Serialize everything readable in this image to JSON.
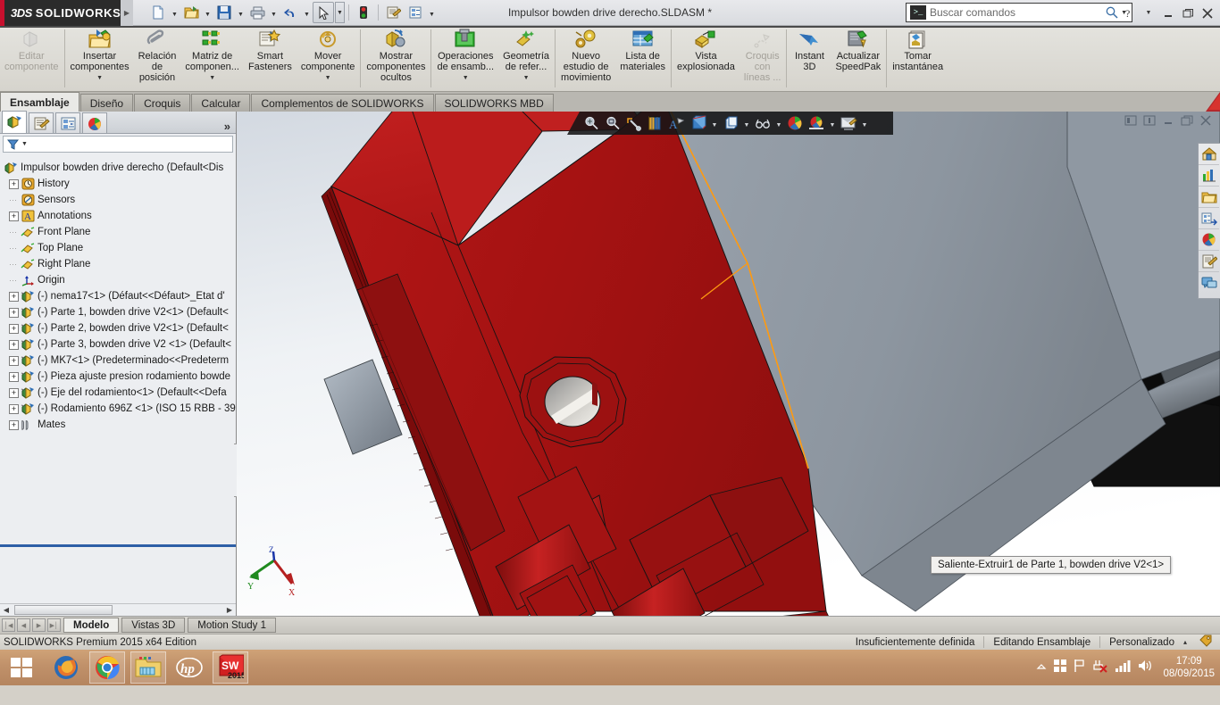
{
  "titlebar": {
    "brand_ds": "3DS",
    "brand_name": "SOLIDWORKS",
    "document_title": "Impulsor bowden drive derecho.SLDASM *",
    "quick_access": [
      {
        "name": "new-document",
        "icon": "new-file-icon",
        "dropdown": true
      },
      {
        "name": "open-document",
        "icon": "open-folder-icon",
        "dropdown": true
      },
      {
        "name": "save-document",
        "icon": "save-disk-icon",
        "dropdown": true
      },
      {
        "name": "print-document",
        "icon": "printer-icon",
        "dropdown": true
      },
      {
        "name": "undo",
        "icon": "undo-arrow-icon",
        "dropdown": true
      },
      {
        "name": "select",
        "icon": "cursor-arrow-icon",
        "dropdown": true
      },
      {
        "name": "rebuild",
        "icon": "traffic-light-icon",
        "dropdown": false
      },
      {
        "name": "file-properties",
        "icon": "properties-icon",
        "dropdown": false
      },
      {
        "name": "options",
        "icon": "options-gear-icon",
        "dropdown": true
      }
    ],
    "window_buttons": [
      "help-icon",
      "help-dropdown",
      "minimize",
      "restore",
      "close"
    ]
  },
  "search": {
    "placeholder": "Buscar comandos",
    "value": "",
    "icon": "command-search-icon"
  },
  "ribbon": {
    "groups": [
      {
        "items": [
          {
            "label": "Editar\ncomponente",
            "icon": "edit-component-icon",
            "disabled": true,
            "dropdown": false
          }
        ]
      },
      {
        "items": [
          {
            "label": "Insertar\ncomponentes",
            "icon": "insert-components-icon",
            "disabled": false,
            "dropdown": true
          },
          {
            "label": "Relación\nde\nposición",
            "icon": "mate-paperclip-icon",
            "disabled": false,
            "dropdown": false
          },
          {
            "label": "Matriz de\ncomponen...",
            "icon": "component-pattern-icon",
            "disabled": false,
            "dropdown": true
          },
          {
            "label": "Smart\nFasteners",
            "icon": "smart-fasteners-icon",
            "disabled": false,
            "dropdown": false
          },
          {
            "label": "Mover\ncomponente",
            "icon": "move-component-icon",
            "disabled": false,
            "dropdown": true
          }
        ]
      },
      {
        "items": [
          {
            "label": "Mostrar\ncomponentes\nocultos",
            "icon": "show-hidden-components-icon",
            "disabled": false,
            "dropdown": false
          }
        ]
      },
      {
        "items": [
          {
            "label": "Operaciones\nde ensamb...",
            "icon": "assembly-features-icon",
            "disabled": false,
            "dropdown": true
          },
          {
            "label": "Geometría\nde refer...",
            "icon": "reference-geometry-icon",
            "disabled": false,
            "dropdown": true
          }
        ]
      },
      {
        "items": [
          {
            "label": "Nuevo\nestudio de\nmovimiento",
            "icon": "new-motion-study-icon",
            "disabled": false,
            "dropdown": false
          },
          {
            "label": "Lista de\nmateriales",
            "icon": "bill-of-materials-icon",
            "disabled": false,
            "dropdown": false
          }
        ]
      },
      {
        "items": [
          {
            "label": "Vista\nexplosionada",
            "icon": "exploded-view-icon",
            "disabled": false,
            "dropdown": false
          },
          {
            "label": "Croquis\ncon\nlíneas ...",
            "icon": "explode-line-sketch-icon",
            "disabled": true,
            "dropdown": false
          }
        ]
      },
      {
        "items": [
          {
            "label": "Instant\n3D",
            "icon": "instant-3d-icon",
            "disabled": false,
            "dropdown": false
          },
          {
            "label": "Actualizar\nSpeedPak",
            "icon": "update-speedpak-icon",
            "disabled": false,
            "dropdown": false
          }
        ]
      },
      {
        "items": [
          {
            "label": "Tomar\ninstantánea",
            "icon": "take-snapshot-icon",
            "disabled": false,
            "dropdown": false
          }
        ]
      }
    ]
  },
  "command_tabs": [
    {
      "label": "Ensamblaje",
      "active": true
    },
    {
      "label": "Diseño",
      "active": false
    },
    {
      "label": "Croquis",
      "active": false
    },
    {
      "label": "Calcular",
      "active": false
    },
    {
      "label": "Complementos de SOLIDWORKS",
      "active": false
    },
    {
      "label": "SOLIDWORKS MBD",
      "active": false
    }
  ],
  "feature_manager": {
    "tabs": [
      {
        "name": "feature-tree-tab",
        "icon": "feature-tree-icon",
        "active": true
      },
      {
        "name": "property-manager-tab",
        "icon": "property-manager-icon",
        "active": false
      },
      {
        "name": "configuration-manager-tab",
        "icon": "configuration-manager-icon",
        "active": false
      },
      {
        "name": "display-manager-tab",
        "icon": "display-manager-icon",
        "active": false
      }
    ],
    "more_label": "»",
    "filter_placeholder": "",
    "tree": [
      {
        "label": "Impulsor bowden drive derecho  (Default<Dis",
        "icon": "assembly-icon",
        "indent": 0,
        "expandable": false,
        "expanded": false,
        "root": true
      },
      {
        "label": "History",
        "icon": "history-clock-icon",
        "indent": 1,
        "expandable": true,
        "expanded": false
      },
      {
        "label": "Sensors",
        "icon": "sensors-icon",
        "indent": 1,
        "expandable": false,
        "expanded": false
      },
      {
        "label": "Annotations",
        "icon": "annotations-icon",
        "indent": 1,
        "expandable": true,
        "expanded": false
      },
      {
        "label": "Front Plane",
        "icon": "plane-icon",
        "indent": 1,
        "expandable": false,
        "expanded": false
      },
      {
        "label": "Top Plane",
        "icon": "plane-icon",
        "indent": 1,
        "expandable": false,
        "expanded": false
      },
      {
        "label": "Right Plane",
        "icon": "plane-icon",
        "indent": 1,
        "expandable": false,
        "expanded": false
      },
      {
        "label": "Origin",
        "icon": "origin-icon",
        "indent": 1,
        "expandable": false,
        "expanded": false
      },
      {
        "label": "(-) nema17<1>  (Défaut<<Défaut>_Etat d'",
        "icon": "component-icon",
        "indent": 1,
        "expandable": true,
        "expanded": false
      },
      {
        "label": "(-) Parte 1, bowden drive V2<1>  (Default<",
        "icon": "component-icon",
        "indent": 1,
        "expandable": true,
        "expanded": false
      },
      {
        "label": "(-) Parte 2, bowden drive V2<1>  (Default<",
        "icon": "component-icon",
        "indent": 1,
        "expandable": true,
        "expanded": false
      },
      {
        "label": "(-) Parte 3, bowden drive V2 <1>  (Default<",
        "icon": "component-icon",
        "indent": 1,
        "expandable": true,
        "expanded": false
      },
      {
        "label": "(-) MK7<1>  (Predeterminado<<Predeterm",
        "icon": "component-icon",
        "indent": 1,
        "expandable": true,
        "expanded": false
      },
      {
        "label": "(-) Pieza ajuste presion rodamiento bowde",
        "icon": "component-icon",
        "indent": 1,
        "expandable": true,
        "expanded": false
      },
      {
        "label": "(-) Eje del rodamiento<1>  (Default<<Defa",
        "icon": "component-icon",
        "indent": 1,
        "expandable": true,
        "expanded": false
      },
      {
        "label": "(-) Rodamiento 696Z <1>  (ISO 15 RBB - 39",
        "icon": "component-icon",
        "indent": 1,
        "expandable": true,
        "expanded": false
      },
      {
        "label": "Mates",
        "icon": "mates-folder-icon",
        "indent": 1,
        "expandable": true,
        "expanded": false
      }
    ]
  },
  "viewport": {
    "toolbar": [
      {
        "name": "zoom-to-fit",
        "icon": "zoom-to-fit-icon",
        "dropdown": false
      },
      {
        "name": "zoom-to-area",
        "icon": "zoom-to-area-icon",
        "dropdown": false
      },
      {
        "name": "previous-view",
        "icon": "previous-view-icon",
        "dropdown": false
      },
      {
        "name": "section-view",
        "icon": "section-view-icon",
        "dropdown": false
      },
      {
        "name": "view-orientation-annotations",
        "icon": "view-annotations-icon",
        "dropdown": false
      },
      {
        "name": "view-orientation",
        "icon": "view-orientation-cube-icon",
        "dropdown": true
      },
      {
        "name": "display-style",
        "icon": "display-style-icon",
        "dropdown": true
      },
      {
        "name": "hide-show-items",
        "icon": "hide-show-glasses-icon",
        "dropdown": true
      },
      {
        "name": "edit-appearance",
        "icon": "appearance-sphere-icon",
        "dropdown": false
      },
      {
        "name": "apply-scene",
        "icon": "apply-scene-icon",
        "dropdown": true
      },
      {
        "name": "view-settings",
        "icon": "view-settings-icon",
        "dropdown": true
      }
    ],
    "window_buttons": [
      "split-vertical",
      "split-horizontal",
      "minimize-doc",
      "restore-doc",
      "close-doc"
    ],
    "tooltip": "Saliente-Extruir1 de Parte 1, bowden drive V2<1>",
    "triad_labels": {
      "x": "X",
      "y": "Y",
      "z": "Z"
    },
    "colors": {
      "part_red": "#a81414",
      "part_red_light": "#c01c1c",
      "part_red_dark": "#8a0f0f",
      "part_gray": "#9099a2",
      "part_black": "#0c0c0c",
      "highlight_edge": "#ff9a10",
      "edge": "#141414",
      "background_top": "#dfe3e8",
      "background_bottom": "#ffffff"
    }
  },
  "task_pane": [
    {
      "name": "sw-resources",
      "icon": "home-house-icon"
    },
    {
      "name": "design-library",
      "icon": "design-library-icon"
    },
    {
      "name": "file-explorer",
      "icon": "folder-icon"
    },
    {
      "name": "view-palette",
      "icon": "view-palette-icon"
    },
    {
      "name": "appearances-scenes",
      "icon": "appearance-sphere-icon"
    },
    {
      "name": "custom-properties",
      "icon": "custom-properties-icon"
    },
    {
      "name": "sw-forum",
      "icon": "forum-speech-icon"
    }
  ],
  "document_tabs": {
    "nav_buttons": [
      "first",
      "previous",
      "next",
      "last"
    ],
    "tabs": [
      {
        "label": "Modelo",
        "active": true
      },
      {
        "label": "Vistas 3D",
        "active": false
      },
      {
        "label": "Motion Study 1",
        "active": false
      }
    ]
  },
  "status_bar": {
    "edition": "SOLIDWORKS Premium 2015 x64 Edition",
    "items": [
      {
        "label": "Insuficientemente definida"
      },
      {
        "label": "Editando Ensamblaje"
      },
      {
        "label": "Personalizado"
      }
    ],
    "units_dropdown": "▴",
    "tag_icon": "tag-icon"
  },
  "taskbar": {
    "start_icon": "windows-start-icon",
    "apps": [
      {
        "name": "firefox",
        "icon": "firefox-icon",
        "running": false
      },
      {
        "name": "google-chrome",
        "icon": "chrome-icon",
        "running": true
      },
      {
        "name": "file-explorer",
        "icon": "explorer-folder-icon",
        "running": true
      },
      {
        "name": "hp-support",
        "icon": "hp-logo-icon",
        "running": false
      },
      {
        "name": "solidworks-2015",
        "icon": "solidworks-2015-icon",
        "running": true
      }
    ],
    "tray": [
      {
        "name": "show-hidden-icons",
        "icon": "chevron-up-icon"
      },
      {
        "name": "windows-action-center",
        "icon": "windows-flag-icon"
      },
      {
        "name": "flag-notification",
        "icon": "flag-icon"
      },
      {
        "name": "network-problem",
        "icon": "network-error-icon"
      },
      {
        "name": "signal-strength",
        "icon": "signal-bars-icon"
      },
      {
        "name": "volume",
        "icon": "speaker-icon"
      }
    ],
    "clock_time": "17:09",
    "clock_date": "08/09/2015"
  }
}
